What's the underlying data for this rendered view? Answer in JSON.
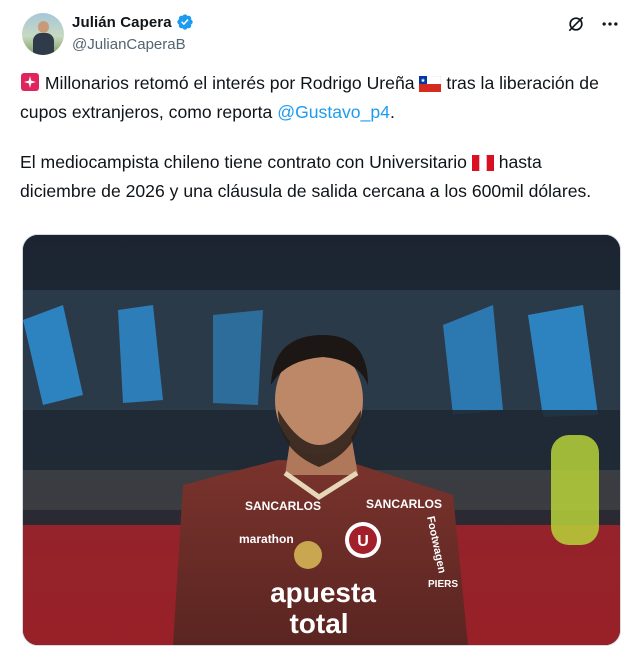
{
  "author": {
    "display_name": "Julián Capera",
    "handle": "@JulianCaperaB",
    "verified": true
  },
  "actions": {
    "grok_icon": "grok-icon",
    "more_icon": "more-icon"
  },
  "tweet": {
    "p1_part1": "Millonarios retomó el interés por Rodrigo Ureña",
    "p1_part2": "tras la liberación de cupos extranjeros, como reporta",
    "mention": "@Gustavo_p4",
    "p1_end": ".",
    "p2_part1": "El mediocampista chileno tiene contrato con Universitario",
    "p2_part2": "hasta diciembre de 2026 y una cláusula de salida cercana a los 600mil dólares."
  },
  "media": {
    "jersey_sponsor": "apuesta",
    "jersey_sponsor2": "total",
    "jersey_brand": "marathon",
    "jersey_left_logo": "SANCARLOS",
    "jersey_right_logo": "SANCARLOS",
    "jersey_crest": "U",
    "sleeve_text": "Footwagen",
    "sleeve_text2": "PIERS"
  },
  "colors": {
    "link": "#1d9bf0",
    "secondary_text": "#536471",
    "verified": "#1d9bf0",
    "jersey": "#6e2e2a"
  }
}
